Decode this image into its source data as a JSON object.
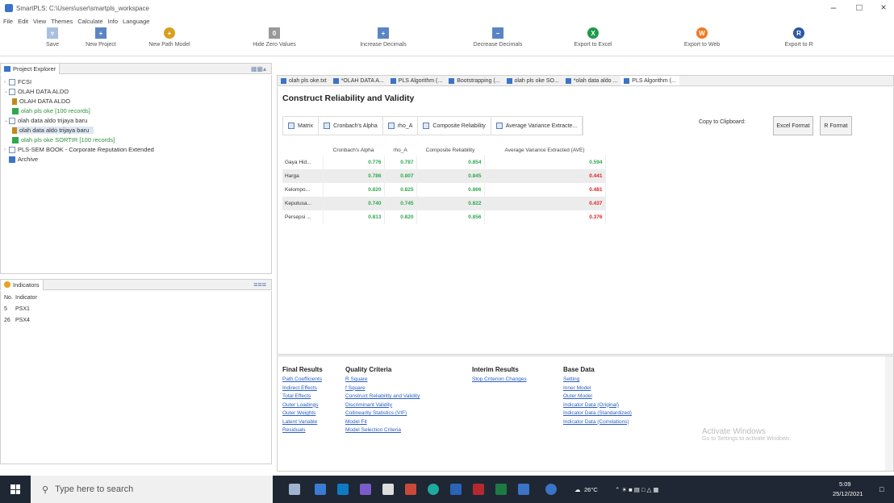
{
  "window": {
    "title": "SmartPLS: C:\\Users\\user\\smartpls_workspace"
  },
  "menu": [
    "File",
    "Edit",
    "View",
    "Themes",
    "Calculate",
    "Info",
    "Language"
  ],
  "toolbar": [
    {
      "label": "Save",
      "icon": "save-icon",
      "color": "#7a9ccf"
    },
    {
      "label": "New Project",
      "icon": "new-project-icon",
      "color": "#5b84c4"
    },
    {
      "label": "New Path Model",
      "icon": "new-path-model-icon",
      "color": "#d9a01e"
    },
    {
      "label": "Hide Zero Values",
      "icon": "hide-zero-icon",
      "color": "#888888"
    },
    {
      "label": "Increase Decimals",
      "icon": "increase-decimals-icon",
      "color": "#5b84c4"
    },
    {
      "label": "Decrease Decimals",
      "icon": "decrease-decimals-icon",
      "color": "#5b84c4"
    },
    {
      "label": "Export to Excel",
      "icon": "excel-icon",
      "color": "#1e9a4a"
    },
    {
      "label": "Export to Web",
      "icon": "web-icon",
      "color": "#f07a22"
    },
    {
      "label": "Export to R",
      "icon": "r-icon",
      "color": "#2c5aa0"
    }
  ],
  "project_explorer": {
    "title": "Project Explorer",
    "items": [
      {
        "label": "FCSI"
      },
      {
        "label": "OLAH DATA ALDO"
      },
      {
        "label": "OLAH DATA ALDO"
      },
      {
        "label": "olah pls oke [100 records]"
      },
      {
        "label": "olah data aldo trijaya baru"
      },
      {
        "label": "olah data aldo trijaya baru"
      },
      {
        "label": "olah pls oke SORTIR [100 records]"
      },
      {
        "label": "PLS-SEM BOOK - Corporate Reputation Extended"
      },
      {
        "label": "Archive"
      }
    ]
  },
  "indicators": {
    "title": "Indicators",
    "headers": [
      "No.",
      "Indicator"
    ],
    "rows": [
      [
        "5",
        "PSX1"
      ],
      [
        "26",
        "PSX4"
      ]
    ]
  },
  "tabs": [
    {
      "label": "olah pls oke.txt"
    },
    {
      "label": "*OLAH DATA A..."
    },
    {
      "label": "PLS Algorithm (..."
    },
    {
      "label": "Bootstrapping (..."
    },
    {
      "label": "olah pls oke SO..."
    },
    {
      "label": "*olah data aldo ..."
    },
    {
      "label": "PLS Algorithm (..."
    }
  ],
  "report": {
    "title": "Construct Reliability and Validity",
    "subtabs": [
      "Matrix",
      "Cronbach's Alpha",
      "rho_A",
      "Composite Reliability",
      "Average Variance Extracte..."
    ],
    "copy_label": "Copy to Clipboard:",
    "excel_btn": "Excel Format",
    "r_btn": "R Format",
    "headers": [
      "",
      "Cronbach's Alpha",
      "rho_A",
      "Composite Reliability",
      "Average Variance Extracted (AVE)"
    ],
    "rows": [
      {
        "name": "Gaya Hid...",
        "alpha": "0.776",
        "rho": "0.787",
        "cr": "0.854",
        "ave": "0.594",
        "ave_red": false
      },
      {
        "name": "Harga",
        "alpha": "0.786",
        "rho": "0.807",
        "cr": "0.845",
        "ave": "0.441",
        "ave_red": true
      },
      {
        "name": "Kelompo...",
        "alpha": "0.820",
        "rho": "0.825",
        "cr": "0.866",
        "ave": "0.481",
        "ave_red": true
      },
      {
        "name": "Keputusa...",
        "alpha": "0.740",
        "rho": "0.745",
        "cr": "0.822",
        "ave": "0.437",
        "ave_red": true
      },
      {
        "name": "Persepsi ...",
        "alpha": "0.813",
        "rho": "0.820",
        "cr": "0.856",
        "ave": "0.376",
        "ave_red": true
      }
    ]
  },
  "nav": {
    "final": {
      "title": "Final Results",
      "items": [
        "Path Coefficients",
        "Indirect Effects",
        "Total Effects",
        "Outer Loadings",
        "Outer Weights",
        "Latent Variable",
        "Residuals"
      ]
    },
    "quality": {
      "title": "Quality Criteria",
      "items": [
        "R Square",
        "f Square",
        "Construct Reliability and Validity",
        "Discriminant Validity",
        "Collinearity Statistics (VIF)",
        "Model Fit",
        "Model Selection Criteria"
      ]
    },
    "interim": {
      "title": "Interim Results",
      "items": [
        "Stop Criterion Changes"
      ]
    },
    "base": {
      "title": "Base Data",
      "items": [
        "Setting",
        "Inner Model",
        "Outer Model",
        "Indicator Data (Original)",
        "Indicator Data (Standardized)",
        "Indicator Data (Correlations)"
      ]
    }
  },
  "watermark": {
    "line1": "Activate Windows",
    "line2": "Go to Settings to activate Windows."
  },
  "taskbar": {
    "search_placeholder": "Type here to search",
    "weather": "26°C",
    "time": "5:09",
    "date": "25/12/2021"
  }
}
